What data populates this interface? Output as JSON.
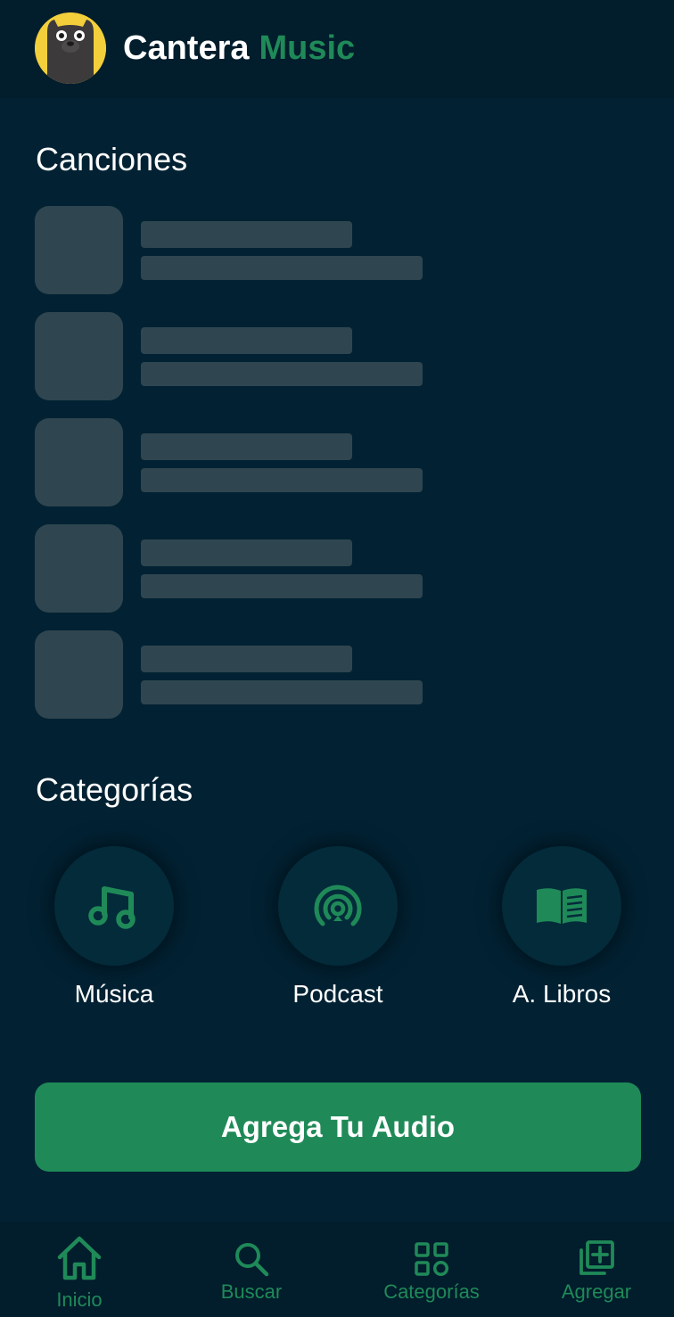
{
  "header": {
    "brand_main": "Cantera",
    "brand_accent": "Music",
    "logo_icon": "bear-logo-icon"
  },
  "songs_section": {
    "title": "Canciones",
    "loading_placeholders": 5
  },
  "categories_section": {
    "title": "Categorías",
    "items": [
      {
        "label": "Música",
        "icon": "music-note-icon"
      },
      {
        "label": "Podcast",
        "icon": "podcast-icon"
      },
      {
        "label": "A. Libros",
        "icon": "book-icon"
      }
    ]
  },
  "cta": {
    "label": "Agrega Tu Audio"
  },
  "bottom_nav": {
    "items": [
      {
        "label": "Inicio",
        "icon": "home-icon",
        "active": true
      },
      {
        "label": "Buscar",
        "icon": "search-icon",
        "active": false
      },
      {
        "label": "Categorías",
        "icon": "grid-icon",
        "active": false
      },
      {
        "label": "Agregar",
        "icon": "add-library-icon",
        "active": false
      }
    ]
  },
  "colors": {
    "background": "#022233",
    "header": "#021d2c",
    "accent": "#1f8a58",
    "skeleton": "#2f4650",
    "text": "#ffffff"
  }
}
